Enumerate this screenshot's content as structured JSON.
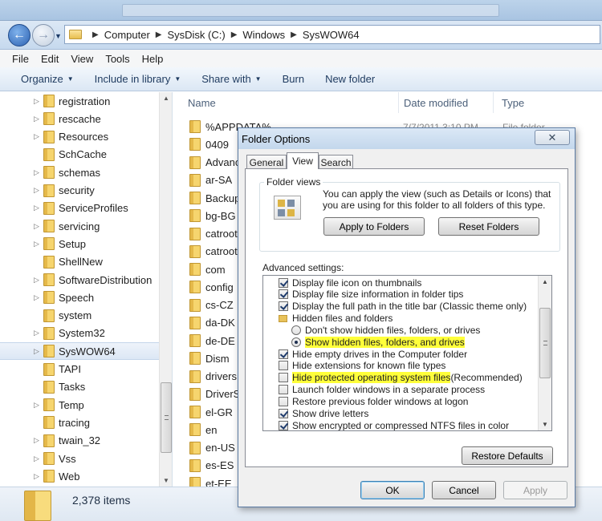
{
  "explorer": {
    "address": {
      "crumbs": [
        "Computer",
        "SysDisk (C:)",
        "Windows",
        "SysWOW64"
      ]
    },
    "menu": [
      "File",
      "Edit",
      "View",
      "Tools",
      "Help"
    ],
    "toolbar": [
      {
        "label": "Organize",
        "dropdown": true
      },
      {
        "label": "Include in library",
        "dropdown": true
      },
      {
        "label": "Share with",
        "dropdown": true
      },
      {
        "label": "Burn",
        "dropdown": false
      },
      {
        "label": "New folder",
        "dropdown": false
      }
    ],
    "nav_tree": [
      {
        "label": "registration",
        "arrow": true
      },
      {
        "label": "rescache",
        "arrow": true
      },
      {
        "label": "Resources",
        "arrow": true
      },
      {
        "label": "SchCache",
        "arrow": false
      },
      {
        "label": "schemas",
        "arrow": true
      },
      {
        "label": "security",
        "arrow": true
      },
      {
        "label": "ServiceProfiles",
        "arrow": true
      },
      {
        "label": "servicing",
        "arrow": true
      },
      {
        "label": "Setup",
        "arrow": true
      },
      {
        "label": "ShellNew",
        "arrow": false
      },
      {
        "label": "SoftwareDistribution",
        "arrow": true
      },
      {
        "label": "Speech",
        "arrow": true
      },
      {
        "label": "system",
        "arrow": false
      },
      {
        "label": "System32",
        "arrow": true
      },
      {
        "label": "SysWOW64",
        "arrow": true,
        "selected": true
      },
      {
        "label": "TAPI",
        "arrow": false
      },
      {
        "label": "Tasks",
        "arrow": false
      },
      {
        "label": "Temp",
        "arrow": true
      },
      {
        "label": "tracing",
        "arrow": false
      },
      {
        "label": "twain_32",
        "arrow": true
      },
      {
        "label": "Vss",
        "arrow": true
      },
      {
        "label": "Web",
        "arrow": true
      }
    ],
    "columns": {
      "name": "Name",
      "date": "Date modified",
      "type": "Type"
    },
    "files": [
      "%APPDATA%",
      "0409",
      "Advanc",
      "ar-SA",
      "Backup",
      "bg-BG",
      "catroot",
      "catroot",
      "com",
      "config",
      "cs-CZ",
      "da-DK",
      "de-DE",
      "Dism",
      "drivers",
      "DriverSt",
      "el-GR",
      "en",
      "en-US",
      "es-ES",
      "et-EE"
    ],
    "first_row_date": "7/7/2011 3:10 PM",
    "first_row_type": "File folder",
    "status": "2,378 items"
  },
  "dialog": {
    "title": "Folder Options",
    "close_glyph": "✕",
    "tabs": [
      "General",
      "View",
      "Search"
    ],
    "active_tab": "View",
    "folder_views": {
      "label": "Folder views",
      "description": "You can apply the view (such as Details or Icons) that you are using for this folder to all folders of this type.",
      "apply_button": "Apply to Folders",
      "reset_button": "Reset Folders"
    },
    "advanced_label": "Advanced settings:",
    "advanced_items": [
      {
        "kind": "check",
        "checked": true,
        "indent": 0,
        "label": "Display file icon on thumbnails"
      },
      {
        "kind": "check",
        "checked": true,
        "indent": 0,
        "label": "Display file size information in folder tips"
      },
      {
        "kind": "check",
        "checked": true,
        "indent": 0,
        "label": "Display the full path in the title bar (Classic theme only)"
      },
      {
        "kind": "folder",
        "indent": 0,
        "label": "Hidden files and folders"
      },
      {
        "kind": "radio",
        "checked": false,
        "indent": 1,
        "label": "Don't show hidden files, folders, or drives"
      },
      {
        "kind": "radio",
        "checked": true,
        "indent": 1,
        "label": "Show hidden files, folders, and drives",
        "highlight": "Show hidden files, folders, and drives",
        "rest": ""
      },
      {
        "kind": "check",
        "checked": true,
        "indent": 0,
        "label": "Hide empty drives in the Computer folder"
      },
      {
        "kind": "check",
        "checked": false,
        "indent": 0,
        "label": "Hide extensions for known file types"
      },
      {
        "kind": "check",
        "checked": false,
        "indent": 0,
        "label": "Hide protected operating system files (Recommended)",
        "highlight": "Hide protected operating system files",
        "rest": " (Recommended)"
      },
      {
        "kind": "check",
        "checked": false,
        "indent": 0,
        "label": "Launch folder windows in a separate process"
      },
      {
        "kind": "check",
        "checked": false,
        "indent": 0,
        "label": "Restore previous folder windows at logon"
      },
      {
        "kind": "check",
        "checked": true,
        "indent": 0,
        "label": "Show drive letters"
      },
      {
        "kind": "check",
        "checked": true,
        "indent": 0,
        "label": "Show encrypted or compressed NTFS files in color"
      }
    ],
    "restore_defaults": "Restore Defaults",
    "ok": "OK",
    "cancel": "Cancel",
    "apply": "Apply"
  }
}
